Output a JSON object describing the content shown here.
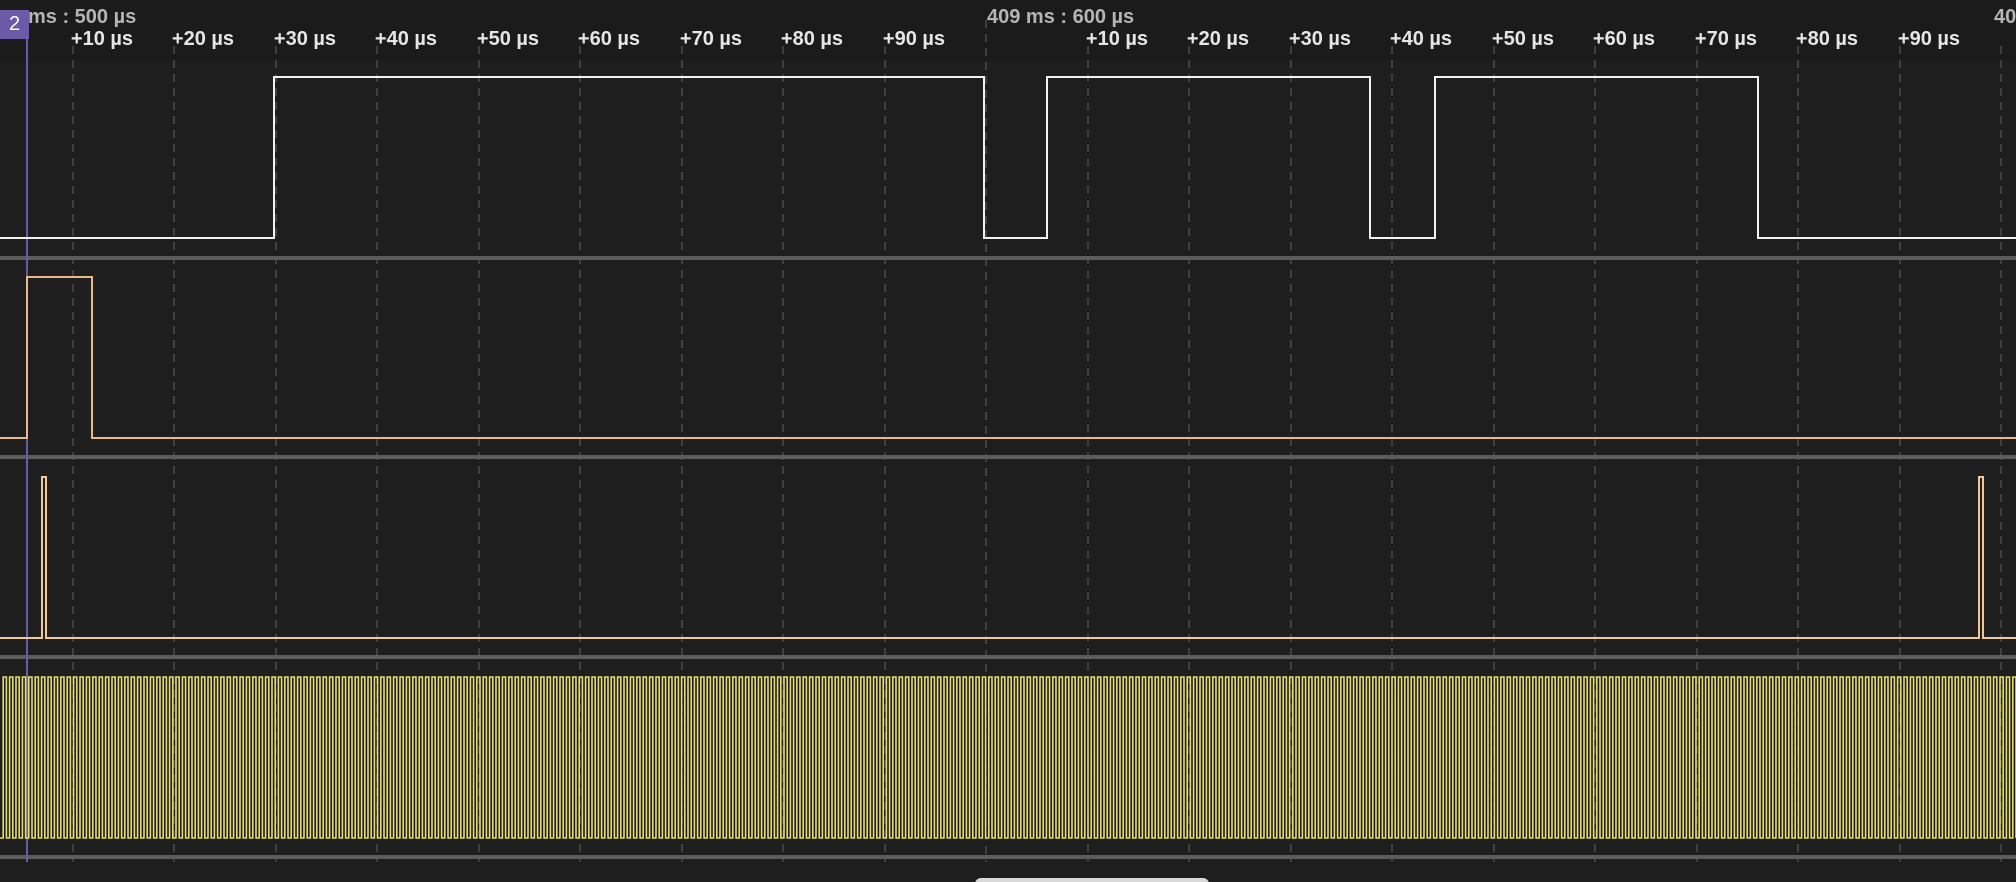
{
  "timeline": {
    "left_major_label": "ms : 500 µs",
    "center_major_label": "409 ms : 600 µs",
    "right_major_label": "40",
    "marker_label": "2",
    "ticks_first_group": [
      "+10 µs",
      "+20 µs",
      "+30 µs",
      "+40 µs",
      "+50 µs",
      "+60 µs",
      "+70 µs",
      "+80 µs",
      "+90 µs"
    ],
    "ticks_second_group": [
      "+10 µs",
      "+20 µs",
      "+30 µs",
      "+40 µs",
      "+50 µs",
      "+60 µs",
      "+70 µs",
      "+80 µs",
      "+90 µs"
    ]
  },
  "channels": [
    {
      "color": "#f2f2f2",
      "description": "digital channel 1"
    },
    {
      "color": "#e9b98a",
      "description": "digital channel 2"
    },
    {
      "color": "#f0c89a",
      "description": "digital channel 3"
    },
    {
      "color": "#e3dc6e",
      "description": "digital channel 4 clock"
    }
  ],
  "colors": {
    "background": "#1e1e1f",
    "marker": "#6a5aa8",
    "grid": "#4a4a4c",
    "separator": "#5c5c5e"
  }
}
